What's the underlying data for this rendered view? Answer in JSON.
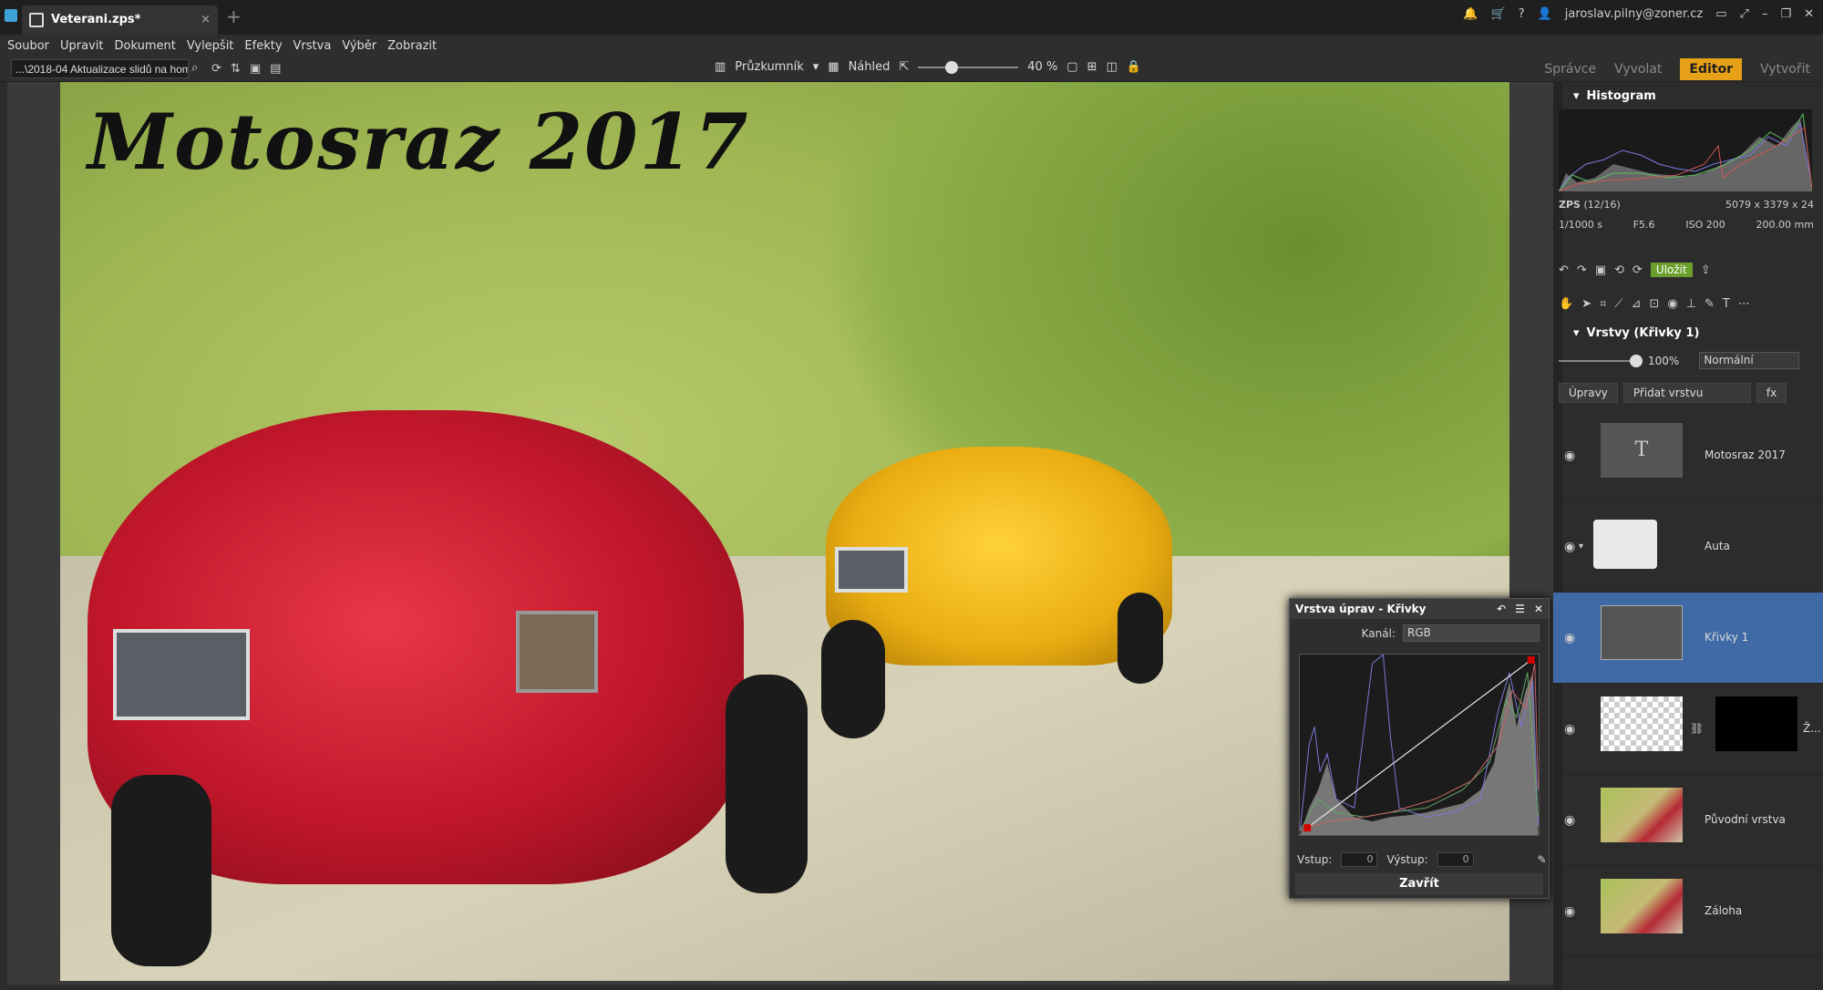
{
  "titlebar": {
    "doc_tab": "Veterani.zps*",
    "account": "jaroslav.pilny@zoner.cz",
    "help": "?"
  },
  "menu": [
    "Soubor",
    "Upravit",
    "Dokument",
    "Vylepšit",
    "Efekty",
    "Vrstva",
    "Výběr",
    "Zobrazit"
  ],
  "toolbar": {
    "path_value": "...\\2018-04 Aktualizace slidů na hom",
    "explorer_label": "Průzkumník",
    "preview_label": "Náhled",
    "zoom": "40 %",
    "zoom_level": 0.33
  },
  "modes": {
    "manager": "Správce",
    "develop": "Vyvolat",
    "editor": "Editor",
    "create": "Vytvořit"
  },
  "canvas": {
    "title": "Motosraz 2017"
  },
  "curves_dialog": {
    "title": "Vrstva úprav - Křivky",
    "channel_label": "Kanál:",
    "channel_value": "RGB",
    "input_label": "Vstup:",
    "input_value": "0",
    "output_label": "Výstup:",
    "output_value": "0",
    "close_label": "Zavřít"
  },
  "panel": {
    "histogram_title": "Histogram",
    "zps": "ZPS",
    "zps_count": "(12/16)",
    "dimensions": "5079 x 3379 x 24",
    "shutter": "1/1000 s",
    "aperture": "F5.6",
    "iso": "ISO 200",
    "focal": "200.00 mm",
    "save_label": "Uložit",
    "layers_title": "Vrstvy (Křivky 1)",
    "opacity": "100%",
    "opacity_level": 1.0,
    "blend_mode": "Normální",
    "adjust_btn": "Úpravy",
    "add_layer_btn": "Přidat vrstvu",
    "fx_btn": "fx"
  },
  "layers": [
    {
      "name": "Motosraz 2017",
      "thumb": "text"
    },
    {
      "name": "Auta",
      "thumb": "folder"
    },
    {
      "name": "Křivky 1",
      "thumb": "curve",
      "selected": true
    },
    {
      "name": "Ž...",
      "thumb": "masked"
    },
    {
      "name": "Původní vrstva",
      "thumb": "photo"
    },
    {
      "name": "Záloha",
      "thumb": "photo"
    }
  ],
  "colors": {
    "accent": "#e6a118",
    "selected_layer": "#3f6aa5",
    "save_green": "#6c9e2d"
  }
}
